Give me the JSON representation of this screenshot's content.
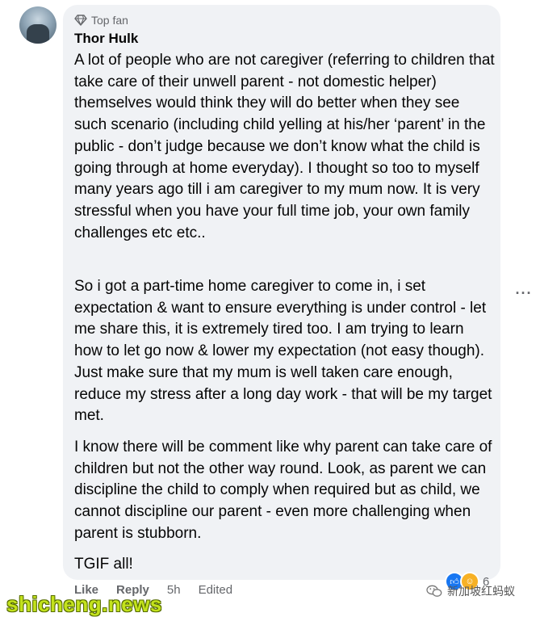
{
  "comment": {
    "badge": "Top fan",
    "author": "Thor Hulk",
    "paragraphs": [
      "A lot of people who are not caregiver (referring to children that take care of their unwell parent - not domestic helper) themselves would think they will do better when they see such scenario (including child yelling at his/her ‘parent’ in the public - don’t judge because we don’t know what the child is going through at home everyday). I thought so too to myself many years ago till i am caregiver to my mum now. It is very stressful when you have your full time job, your own family challenges etc etc..",
      "So i got a part-time home caregiver to come in, i set expectation & want to ensure everything is under control - let me share this, it is extremely tired too. I am trying to learn how to let go now & lower my expectation (not easy though). Just make sure that my mum is well taken care enough, reduce my stress after a long day work - that will be my target met.",
      "I know there will be comment like why parent can take care of children but not the other way round. Look, as parent we can discipline the child to comply when required but as child, we cannot discipline our parent - even more challenging when parent is stubborn.",
      "TGIF all!"
    ]
  },
  "actions": {
    "like": "Like",
    "reply": "Reply",
    "time": "5h",
    "edited": "Edited"
  },
  "reactions": {
    "count": "6"
  },
  "watermarks": {
    "left": "shicheng.news",
    "right": "新加坡红蚂蚁"
  },
  "colors": {
    "bubble": "#f0f2f5",
    "text": "#050505",
    "muted": "#65676b",
    "like_reaction": "#1877f2",
    "watermark": "#c3e21c"
  },
  "icons": {
    "badge": "diamond-icon",
    "more": "more-options-icon",
    "reaction_1": "like-reaction-icon",
    "reaction_2": "care-reaction-icon"
  }
}
